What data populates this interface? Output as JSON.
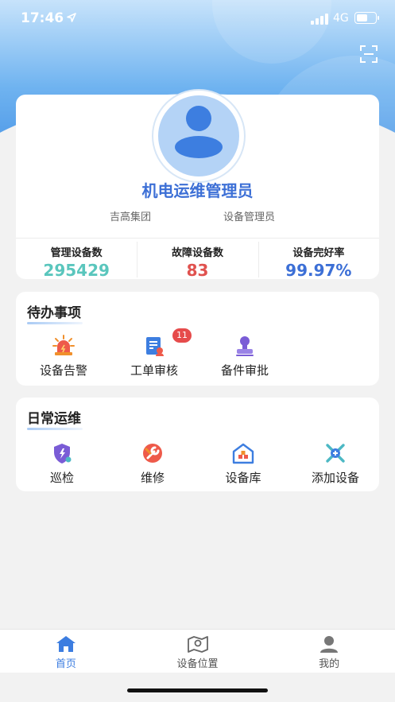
{
  "status_bar": {
    "time": "17:46",
    "network": "4G",
    "battery_level": 0.6
  },
  "profile": {
    "name": "机电运维管理员",
    "organization": "吉高集团",
    "role": "设备管理员"
  },
  "stats": [
    {
      "label": "管理设备数",
      "value": "295429",
      "color": "#5ac6bd"
    },
    {
      "label": "故障设备数",
      "value": "83",
      "color": "#e0524f"
    },
    {
      "label": "设备完好率",
      "value": "99.97%",
      "color": "#3c6fd6"
    }
  ],
  "todo": {
    "title": "待办事项",
    "items": [
      {
        "label": "设备告警",
        "icon": "alarm-light-icon"
      },
      {
        "label": "工单审核",
        "icon": "work-order-icon",
        "badge": "11"
      },
      {
        "label": "备件审批",
        "icon": "approval-stamp-icon"
      }
    ]
  },
  "daily": {
    "title": "日常运维",
    "items": [
      {
        "label": "巡检",
        "icon": "inspection-shield-icon"
      },
      {
        "label": "维修",
        "icon": "repair-wrench-icon"
      },
      {
        "label": "设备库",
        "icon": "warehouse-icon"
      },
      {
        "label": "添加设备",
        "icon": "add-device-tools-icon"
      }
    ]
  },
  "tabs": [
    {
      "label": "首页",
      "icon": "home-icon",
      "active": true
    },
    {
      "label": "设备位置",
      "icon": "map-location-icon",
      "active": false
    },
    {
      "label": "我的",
      "icon": "profile-icon",
      "active": false
    }
  ],
  "colors": {
    "accent": "#3c6fd6",
    "tab_active": "#3c7de0",
    "tab_inactive": "#555555"
  }
}
